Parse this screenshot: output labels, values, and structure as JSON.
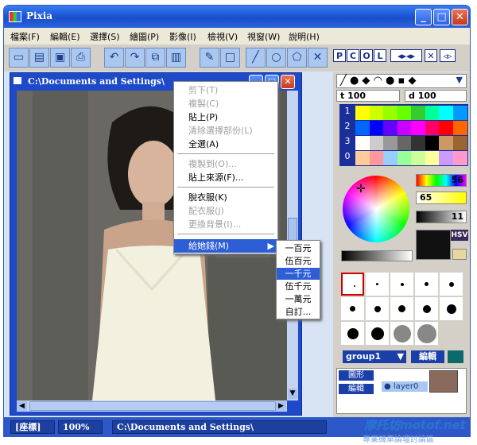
{
  "window": {
    "title": "Pixia"
  },
  "menu": {
    "items": [
      "檔案(F)",
      "編輯(E)",
      "選擇(S)",
      "繪圖(P)",
      "影像(I)",
      "檢視(V)",
      "視窗(W)",
      "說明(H)"
    ]
  },
  "toolbar": {
    "pcol": [
      "P",
      "C",
      "O",
      "L"
    ]
  },
  "document": {
    "title": "C:\\Documents and Settings\\"
  },
  "status": {
    "coord": "[座標]",
    "zoom": "100%",
    "path": "C:\\Documents and Settings\\"
  },
  "context_menu": {
    "items": [
      {
        "label": "剪下(T)",
        "disabled": true
      },
      {
        "label": "複製(C)",
        "disabled": true
      },
      {
        "label": "貼上(P)",
        "disabled": false
      },
      {
        "label": "清除選擇部份(L)",
        "disabled": true
      },
      {
        "label": "全選(A)",
        "disabled": false
      },
      {
        "label": "複製到(O)...",
        "disabled": true
      },
      {
        "label": "貼上來源(F)...",
        "disabled": false
      },
      {
        "label": "脫衣服(K)",
        "disabled": false
      },
      {
        "label": "配衣服(J)",
        "disabled": true
      },
      {
        "label": "更換背景(I)...",
        "disabled": true
      },
      {
        "label": "給她錢(M)",
        "disabled": false,
        "highlighted": true
      }
    ]
  },
  "submenu": {
    "items": [
      "一百元",
      "伍百元",
      "一千元",
      "伍千元",
      "一萬元",
      "自訂..."
    ],
    "highlighted_index": 2
  },
  "right_panel": {
    "t_value": "100",
    "d_value": "100",
    "palette_rows": [
      "1",
      "2",
      "3",
      "0"
    ],
    "color_values": {
      "v1": "56",
      "v2": "65",
      "v3": "11"
    },
    "hsv_label": "HSV",
    "layer_group": "group1",
    "edit_label": "編輯",
    "layer_shape_label": "圖形",
    "layer_edit_label": "編輯",
    "layer_name": "layer0"
  },
  "watermark": {
    "text": "摩托坊motof.net",
    "subtext": "專業機車論壇討論區"
  }
}
